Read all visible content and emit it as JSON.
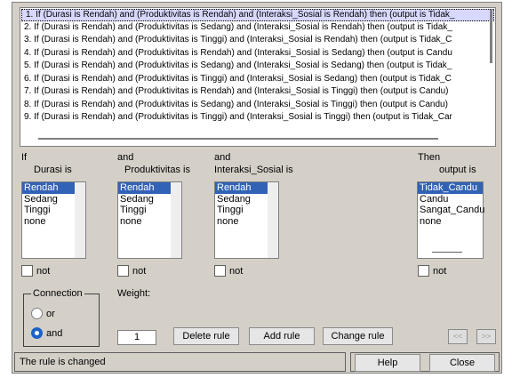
{
  "rules": [
    "1. If (Durasi is Rendah) and (Produktivitas is Rendah) and (Interaksi_Sosial is Rendah) then (output is Tidak_",
    "2. If (Durasi is Rendah) and (Produktivitas is Sedang) and (Interaksi_Sosial is Rendah) then (output is Tidak_",
    "3. If (Durasi is Rendah) and (Produktivitas is Tinggi) and (Interaksi_Sosial is Rendah) then (output is Tidak_C",
    "4. If (Durasi is Rendah) and (Produktivitas is Rendah) and (Interaksi_Sosial is Sedang) then (output is Candu",
    "5. If (Durasi is Rendah) and (Produktivitas is Sedang) and (Interaksi_Sosial is Sedang) then (output is Tidak_",
    "6. If (Durasi is Rendah) and (Produktivitas is Tinggi) and (Interaksi_Sosial is Sedang) then (output is Tidak_C",
    "7. If (Durasi is Rendah) and (Produktivitas is Rendah) and (Interaksi_Sosial is Tinggi) then (output is Candu)",
    "8. If (Durasi is Rendah) and (Produktivitas is Sedang) and (Interaksi_Sosial is Tinggi) then (output is Candu)",
    "9. If (Durasi is Rendah) and (Produktivitas is Tinggi) and (Interaksi_Sosial is Tinggi) then (output is Tidak_Car"
  ],
  "antecedents": [
    {
      "prefix": "If",
      "name": "Durasi is",
      "options": [
        "Rendah",
        "Sedang",
        "Tinggi",
        "none"
      ],
      "selected": "Rendah",
      "not_label": "not"
    },
    {
      "prefix": "and",
      "name": "Produktivitas is",
      "options": [
        "Rendah",
        "Sedang",
        "Tinggi",
        "none"
      ],
      "selected": "Rendah",
      "not_label": "not"
    },
    {
      "prefix": "and",
      "name": "Interaksi_Sosial is",
      "options": [
        "Rendah",
        "Sedang",
        "Tinggi",
        "none"
      ],
      "selected": "Rendah",
      "not_label": "not"
    }
  ],
  "consequent": {
    "prefix": "Then",
    "name": "output is",
    "options": [
      "Tidak_Candu",
      "Candu",
      "Sangat_Candu",
      "none"
    ],
    "selected": "Tidak_Candu",
    "not_label": "not"
  },
  "connection": {
    "title": "Connection",
    "options": [
      "or",
      "and"
    ],
    "selected": "and"
  },
  "weight": {
    "label": "Weight:",
    "value": "1"
  },
  "buttons": {
    "delete": "Delete rule",
    "add": "Add rule",
    "change": "Change rule",
    "prev": "<<",
    "next": ">>",
    "help": "Help",
    "close": "Close"
  },
  "status": "The rule is changed",
  "colors": {
    "window_bg": "#d4d0c8",
    "selection": "#3162b5",
    "radio_selected": "#1c62c8"
  }
}
